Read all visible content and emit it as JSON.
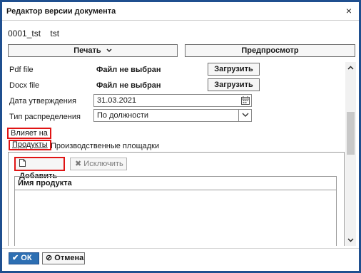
{
  "dialog": {
    "title": "Редактор версии документа",
    "close_glyph": "×"
  },
  "document": {
    "code": "0001_tst",
    "name": "tst"
  },
  "toolbar": {
    "print_label": "Печать",
    "print_icon": "chevron-down-icon",
    "preview_label": "Предпросмотр"
  },
  "form": {
    "pdf_label": "Pdf file",
    "pdf_value": "Файл не выбран",
    "docx_label": "Docx file",
    "docx_value": "Файл не выбран",
    "upload_label": "Загрузить",
    "approval_date_label": "Дата утверждения",
    "approval_date_value": "31.03.2021",
    "distribution_type_label": "Тип распределения",
    "distribution_type_value": "По должности"
  },
  "affects": {
    "label": "Влияет на",
    "tabs": [
      {
        "label": "Продукты",
        "active": true
      },
      {
        "label": "Производственные площадки",
        "active": false
      }
    ]
  },
  "products_panel": {
    "add_label": "Добавить",
    "exclude_label": "Исключить",
    "column_header": "Имя продукта",
    "rows": []
  },
  "footer": {
    "ok_label": "ОК",
    "cancel_label": "Отмена"
  },
  "colors": {
    "title_border": "#1f4f8f",
    "primary_button": "#2d6fb3",
    "highlight": "#e01414"
  }
}
